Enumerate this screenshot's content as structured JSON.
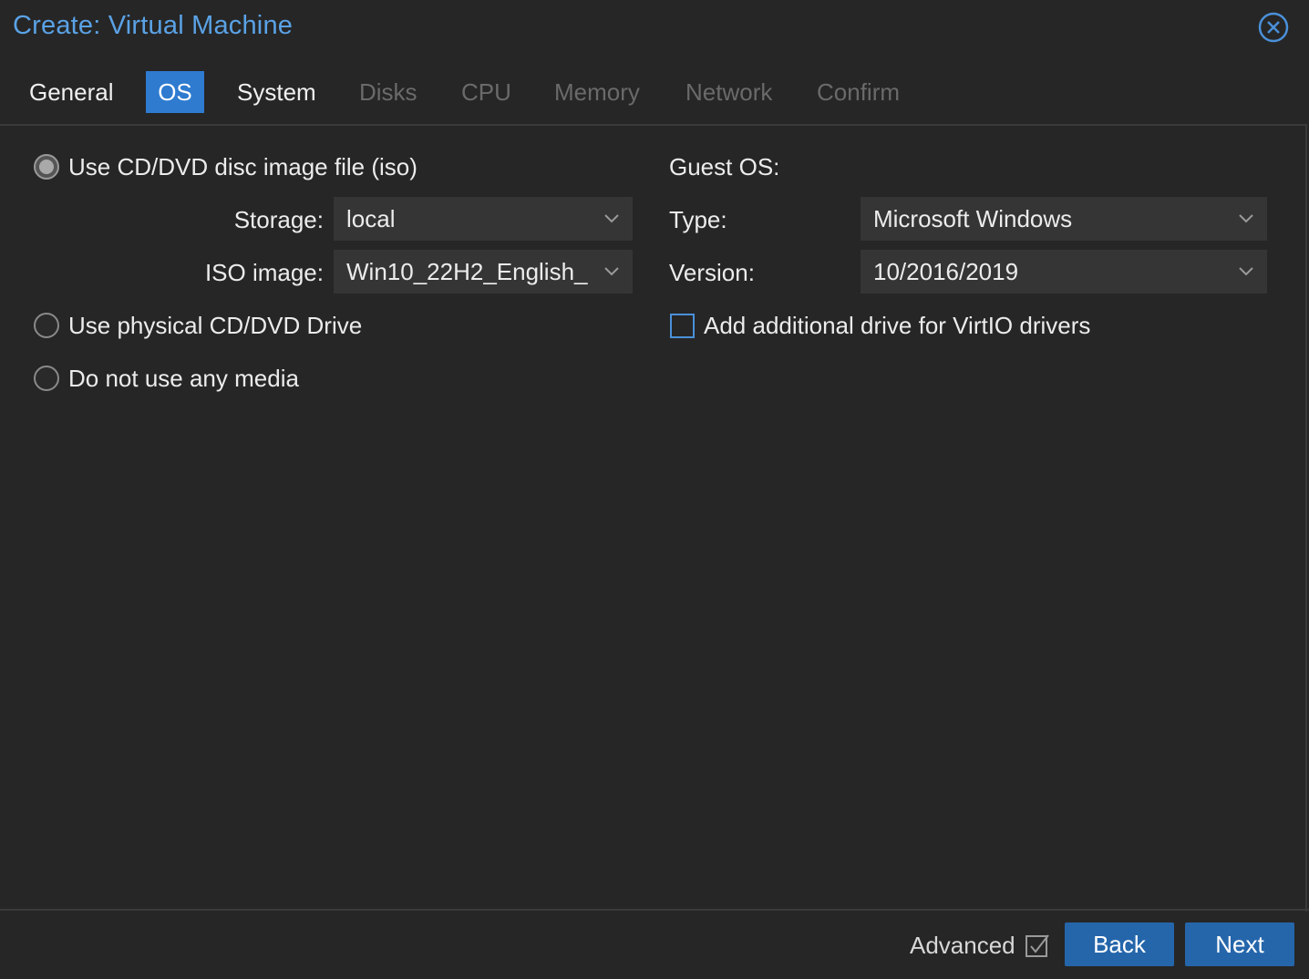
{
  "window": {
    "title": "Create: Virtual Machine"
  },
  "tabs": [
    {
      "label": "General",
      "state": "enabled"
    },
    {
      "label": "OS",
      "state": "active"
    },
    {
      "label": "System",
      "state": "enabled"
    },
    {
      "label": "Disks",
      "state": "disabled"
    },
    {
      "label": "CPU",
      "state": "disabled"
    },
    {
      "label": "Memory",
      "state": "disabled"
    },
    {
      "label": "Network",
      "state": "disabled"
    },
    {
      "label": "Confirm",
      "state": "disabled"
    }
  ],
  "media": {
    "iso_option": {
      "label": "Use CD/DVD disc image file (iso)",
      "checked": true
    },
    "storage": {
      "label": "Storage:",
      "value": "local"
    },
    "iso_image": {
      "label": "ISO image:",
      "value": "Win10_22H2_English_"
    },
    "physical_option": {
      "label": "Use physical CD/DVD Drive",
      "checked": false
    },
    "none_option": {
      "label": "Do not use any media",
      "checked": false
    }
  },
  "guest_os": {
    "heading": "Guest OS:",
    "type": {
      "label": "Type:",
      "value": "Microsoft Windows"
    },
    "version": {
      "label": "Version:",
      "value": "10/2016/2019"
    },
    "virtio": {
      "label": "Add additional drive for VirtIO drivers",
      "checked": false
    }
  },
  "footer": {
    "advanced_label": "Advanced",
    "advanced_checked": true,
    "back_label": "Back",
    "next_label": "Next"
  },
  "colors": {
    "accent": "#2e7bd0",
    "title": "#5aa2e6",
    "button": "#2566ab",
    "background": "#262626"
  }
}
